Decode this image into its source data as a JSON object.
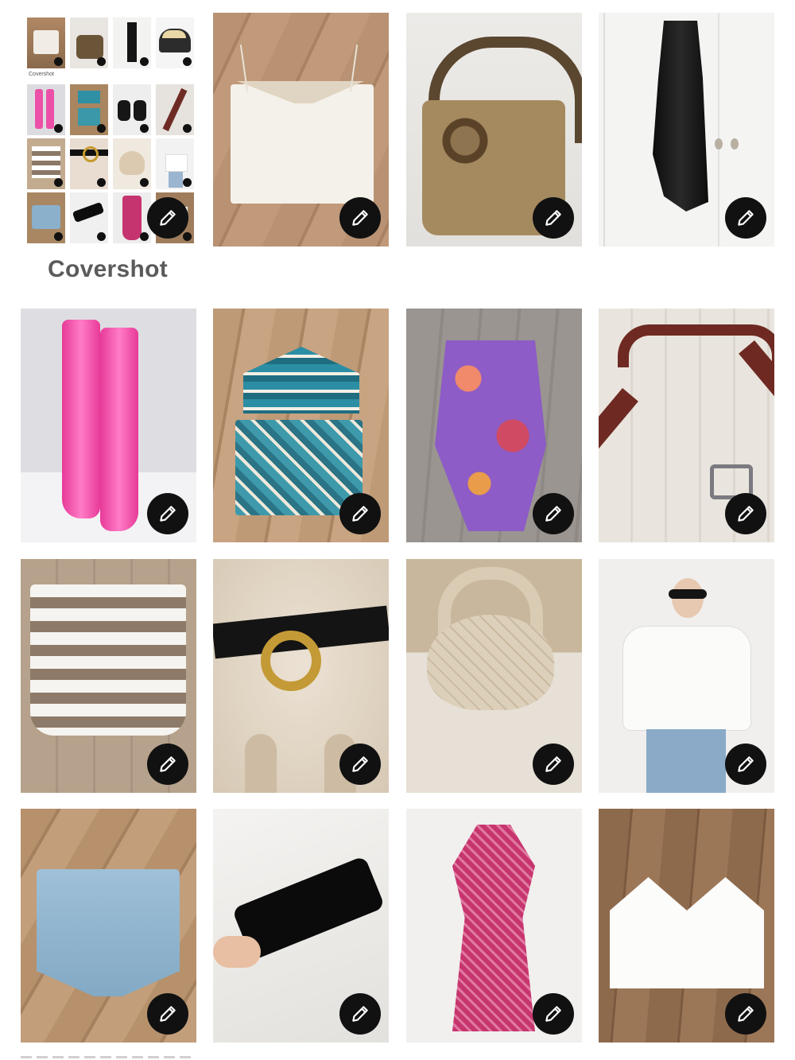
{
  "cover": {
    "label": "Covershot",
    "mini_caption": "Covershot"
  },
  "tiles": [
    {
      "item": "lace-camisole"
    },
    {
      "item": "snakeskin-shoulder-bag"
    },
    {
      "item": "black-slip-dress"
    },
    {
      "item": "pink-cowboy-boots"
    },
    {
      "item": "crochet-top-shorts-set"
    },
    {
      "item": "floral-one-piece-swimsuit"
    },
    {
      "item": "brown-studded-belt"
    },
    {
      "item": "knit-striped-shorts"
    },
    {
      "item": "black-ring-belt"
    },
    {
      "item": "woven-hobo-bag"
    },
    {
      "item": "white-eyelet-tie-top"
    },
    {
      "item": "denim-shorts"
    },
    {
      "item": "black-sunglasses"
    },
    {
      "item": "pink-printed-dress"
    },
    {
      "item": "white-lace-bralette"
    }
  ],
  "icons": {
    "edit": "pencil-icon"
  }
}
